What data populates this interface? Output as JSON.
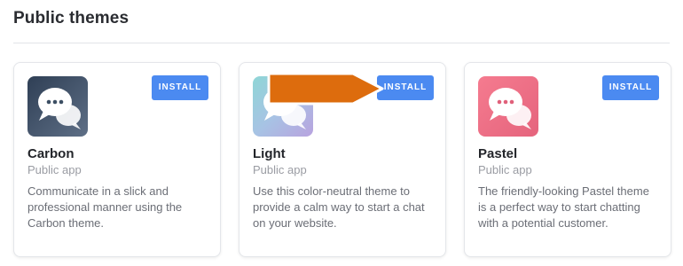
{
  "section": {
    "title": "Public themes"
  },
  "themes": [
    {
      "name": "Carbon",
      "subtitle": "Public app",
      "description": "Communicate in a slick and professional manner using the Carbon theme.",
      "install_label": "INSTALL",
      "icon": "chat-bubbles-icon"
    },
    {
      "name": "Light",
      "subtitle": "Public app",
      "description": "Use this color-neutral theme to provide a calm way to start a chat on your website.",
      "install_label": "INSTALL",
      "icon": "chat-bubbles-icon"
    },
    {
      "name": "Pastel",
      "subtitle": "Public app",
      "description": "The friendly-looking Pastel theme is a perfect way to start chatting with a potential customer.",
      "install_label": "INSTALL",
      "icon": "chat-bubbles-icon"
    }
  ],
  "colors": {
    "install_button": "#4b8af1",
    "carbon_icon": "#3c4e63",
    "light_icon": "#a9c2e2",
    "pastel_icon": "#ee6f85",
    "highlight_arrow": "#dd6c0d"
  }
}
